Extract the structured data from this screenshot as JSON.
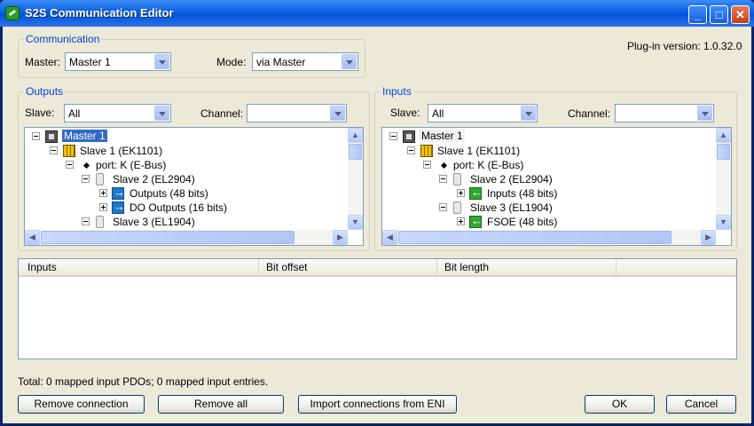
{
  "window": {
    "title": "S2S Communication Editor"
  },
  "communication": {
    "legend": "Communication",
    "master_label": "Master:",
    "master_value": "Master 1",
    "mode_label": "Mode:",
    "mode_value": "via Master",
    "plugin_version": "Plug-in version: 1.0.32.0"
  },
  "outputs": {
    "legend": "Outputs",
    "slave_label": "Slave:",
    "slave_value": "All",
    "channel_label": "Channel:",
    "channel_value": "",
    "tree": [
      "Master 1",
      "Slave 1 (EK1101)",
      "port: K (E-Bus)",
      "Slave 2 (EL2904)",
      "Outputs (48 bits)",
      "DO Outputs (16 bits)",
      "Slave 3 (EL1904)"
    ]
  },
  "inputs": {
    "legend": "Inputs",
    "slave_label": "Slave:",
    "slave_value": "All",
    "channel_label": "Channel:",
    "channel_value": "",
    "tree": [
      "Master 1",
      "Slave 1 (EK1101)",
      "port: K (E-Bus)",
      "Slave 2 (EL2904)",
      "Inputs (48 bits)",
      "Slave 3 (EL1904)",
      "FSOE  (48 bits)"
    ]
  },
  "mapping_table": {
    "columns": [
      "Inputs",
      "Bit offset",
      "Bit length"
    ],
    "rows": []
  },
  "status": {
    "total": "Total: 0 mapped input PDOs; 0 mapped input entries."
  },
  "buttons": {
    "remove_connection": "Remove connection",
    "remove_all": "Remove all",
    "import_eni": "Import connections from ENI",
    "ok": "OK",
    "cancel": "Cancel"
  },
  "colors": {
    "title_bar": "#0a5fe0",
    "group_legend": "#0046d5",
    "selection": "#316ac5",
    "dialog_bg": "#ece9d8"
  }
}
